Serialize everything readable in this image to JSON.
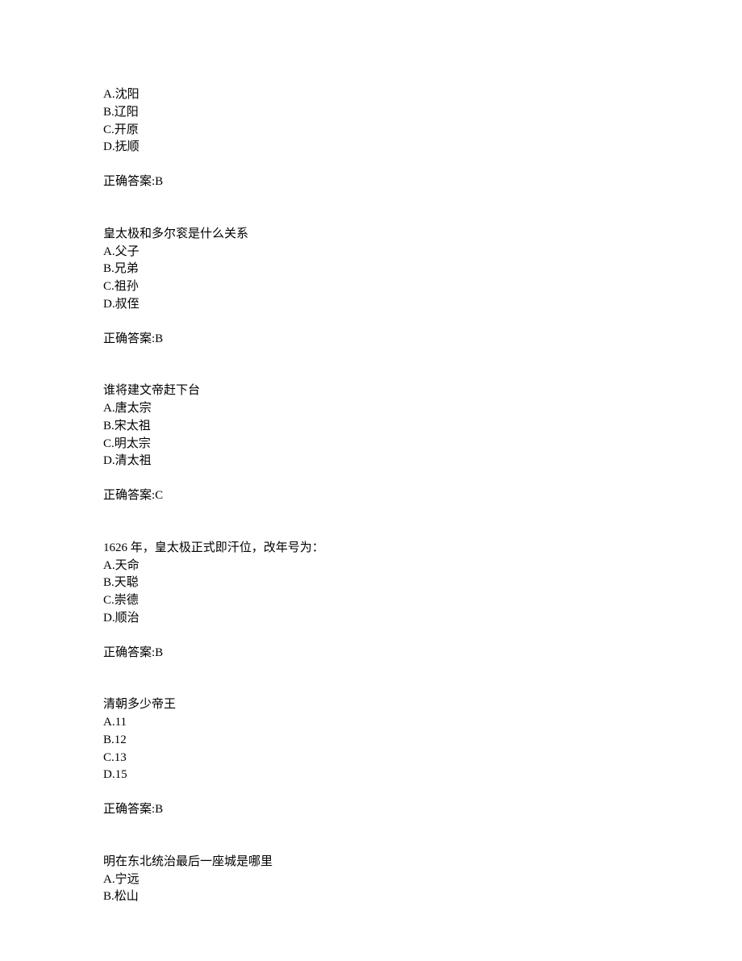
{
  "questions": [
    {
      "text": "",
      "options": [
        "A.沈阳",
        "B.辽阳",
        "C.开原",
        "D.抚顺"
      ],
      "answer": "正确答案:B"
    },
    {
      "text": "皇太极和多尔衮是什么关系",
      "options": [
        "A.父子",
        "B.兄弟",
        "C.祖孙",
        "D.叔侄"
      ],
      "answer": "正确答案:B"
    },
    {
      "text": "谁将建文帝赶下台",
      "options": [
        "A.唐太宗",
        "B.宋太祖",
        "C.明太宗",
        "D.清太祖"
      ],
      "answer": "正确答案:C"
    },
    {
      "text": "1626 年，皇太极正式即汗位，改年号为：",
      "options": [
        "A.天命",
        "B.天聪",
        "C.崇德",
        "D.顺治"
      ],
      "answer": "正确答案:B"
    },
    {
      "text": "清朝多少帝王",
      "options": [
        "A.11",
        "B.12",
        "C.13",
        "D.15"
      ],
      "answer": "正确答案:B"
    },
    {
      "text": "明在东北统治最后一座城是哪里",
      "options": [
        "A.宁远",
        "B.松山"
      ],
      "answer": ""
    }
  ]
}
